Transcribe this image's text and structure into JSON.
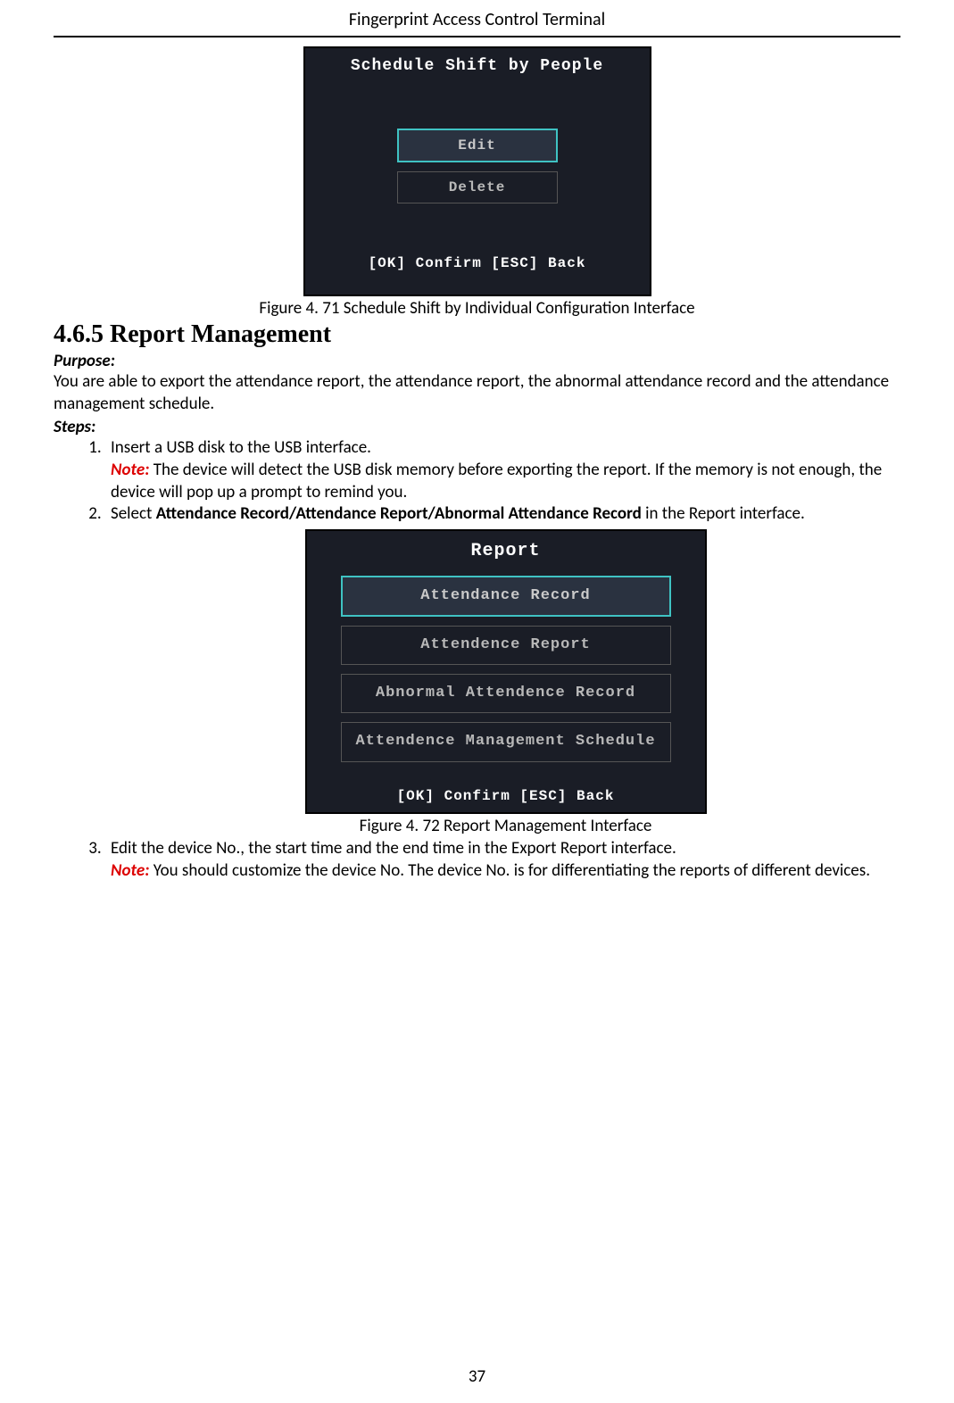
{
  "header": "Fingerprint Access Control Terminal",
  "figure71": {
    "caption": "Figure 4. 71 Schedule Shift by Individual Configuration Interface",
    "screen": {
      "title": "Schedule Shift by People",
      "edit": "Edit",
      "delete": "Delete",
      "footer": "[OK] Confirm   [ESC] Back"
    }
  },
  "section": {
    "heading": "4.6.5   Report Management",
    "purpose_label": "Purpose:",
    "purpose_text": "You are able to export the attendance report, the attendance report, the abnormal attendance record and the attendance management schedule.",
    "steps_label": "Steps:"
  },
  "steps": {
    "s1": {
      "line1": "Insert a USB disk to the USB interface.",
      "note_label": "Note:",
      "note_text": " The device will detect the USB disk memory before exporting the report. If the memory is not enough, the device will pop up a prompt to remind you."
    },
    "s2": {
      "pre": "Select ",
      "bold": "Attendance Record/Attendance Report/Abnormal Attendance Record",
      "post": " in the Report interface."
    },
    "s3": {
      "line1": "Edit the device No., the start time and the end time in the Export Report interface.",
      "note_label": "Note:",
      "note_text": " You should customize the device No. The device No. is for differentiating the reports of different devices."
    }
  },
  "figure72": {
    "caption": "Figure 4. 72 Report Management Interface",
    "screen": {
      "title": "Report",
      "item1": "Attendance Record",
      "item2": "Attendence Report",
      "item3": "Abnormal Attendence Record",
      "item4": "Attendence Management Schedule",
      "footer": "[OK] Confirm   [ESC] Back"
    }
  },
  "page_number": "37"
}
